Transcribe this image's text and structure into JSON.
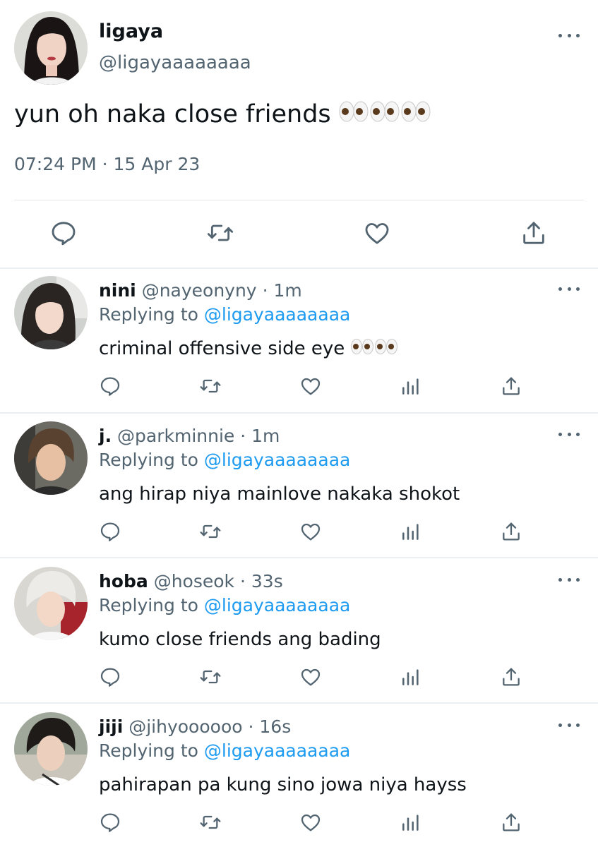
{
  "main_tweet": {
    "display_name": "ligaya",
    "handle": "@ligayaaaaaaaa",
    "text": "yun oh naka close friends",
    "emoji": "👀👀👀",
    "time": "07:24 PM",
    "separator": "·",
    "date": "15 Apr 23",
    "actions": [
      "reply-icon",
      "retweet-icon",
      "like-icon",
      "share-icon"
    ]
  },
  "replies": [
    {
      "display_name": "nini",
      "handle": "@nayeonyny",
      "separator": "·",
      "time": "1m",
      "replying_label": "Replying to",
      "replying_to": "@ligayaaaaaaaa",
      "text": "criminal offensive side eye",
      "emoji": "👀👀"
    },
    {
      "display_name": "j.",
      "handle": "@parkminnie",
      "separator": "·",
      "time": "1m",
      "replying_label": "Replying to",
      "replying_to": "@ligayaaaaaaaa",
      "text": "ang hirap niya mainlove nakaka shokot"
    },
    {
      "display_name": "hoba",
      "handle": "@hoseok",
      "separator": "·",
      "time": "33s",
      "replying_label": "Replying to",
      "replying_to": "@ligayaaaaaaaa",
      "text": "kumo close friends ang bading"
    },
    {
      "display_name": "jiji",
      "handle": "@jihyoooooo",
      "separator": "·",
      "time": "16s",
      "replying_label": "Replying to",
      "replying_to": "@ligayaaaaaaaa",
      "text": "pahirapan pa kung sino jowa niya hayss"
    }
  ],
  "reply_actions": [
    "reply-icon",
    "retweet-icon",
    "like-icon",
    "analytics-icon",
    "share-icon"
  ],
  "colors": {
    "text": "#0f1419",
    "secondary": "#536471",
    "link": "#1d9bf0",
    "divider": "#eceff1"
  }
}
